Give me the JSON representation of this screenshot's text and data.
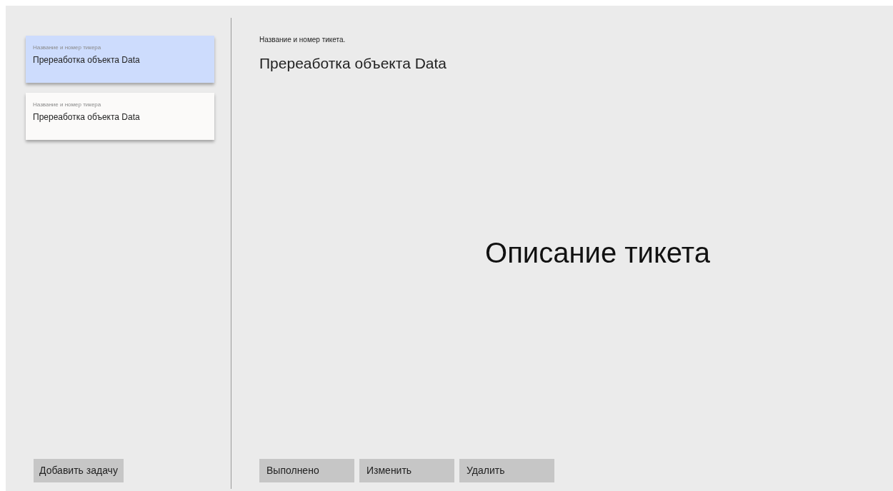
{
  "tickets": [
    {
      "label": "Название и номер тикера",
      "title": "Пререаботка объекта Data",
      "selected": true
    },
    {
      "label": "Название и номер тикера",
      "title": "Пререаботка объекта Data",
      "selected": false
    }
  ],
  "add_button": "Добавить задачу",
  "detail": {
    "label": "Название и номер тикета.",
    "title": "Пререаботка объекта Data",
    "description": "Описание тикета"
  },
  "actions": [
    "Выполнено",
    "Изменить",
    "Удалить"
  ]
}
